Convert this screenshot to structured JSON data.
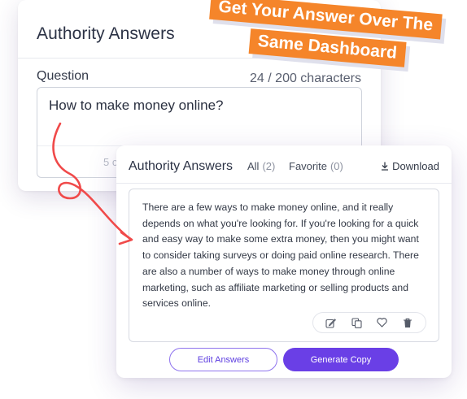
{
  "back_card": {
    "title": "Authority Answers",
    "question_label": "Question",
    "char_count": "24 / 200 characters",
    "question_text": "How to make money online?",
    "ghost_text": "5 c"
  },
  "banner": {
    "line1": "Get Your Answer Over The",
    "line2": "Same Dashboard",
    "color": "#f5852a"
  },
  "front_card": {
    "title": "Authority Answers",
    "tabs": [
      {
        "label": "All",
        "count": "(2)"
      },
      {
        "label": "Favorite",
        "count": "(0)"
      }
    ],
    "download_label": "Download",
    "answer": "There are a few ways to make money online, and it really depends on what you're looking for. If you're looking for a quick and easy way to make some extra money, then you might want to consider taking surveys or doing paid online research. There are also a number of ways to make money through online marketing, such as affiliate marketing or selling products and services online.",
    "actions": [
      "edit-icon",
      "copy-icon",
      "heart-icon",
      "trash-icon"
    ],
    "edit_button": "Edit Answers",
    "generate_button": "Generate Copy",
    "accent": "#6a3fe6"
  },
  "arrow_color": "#f04a4a"
}
